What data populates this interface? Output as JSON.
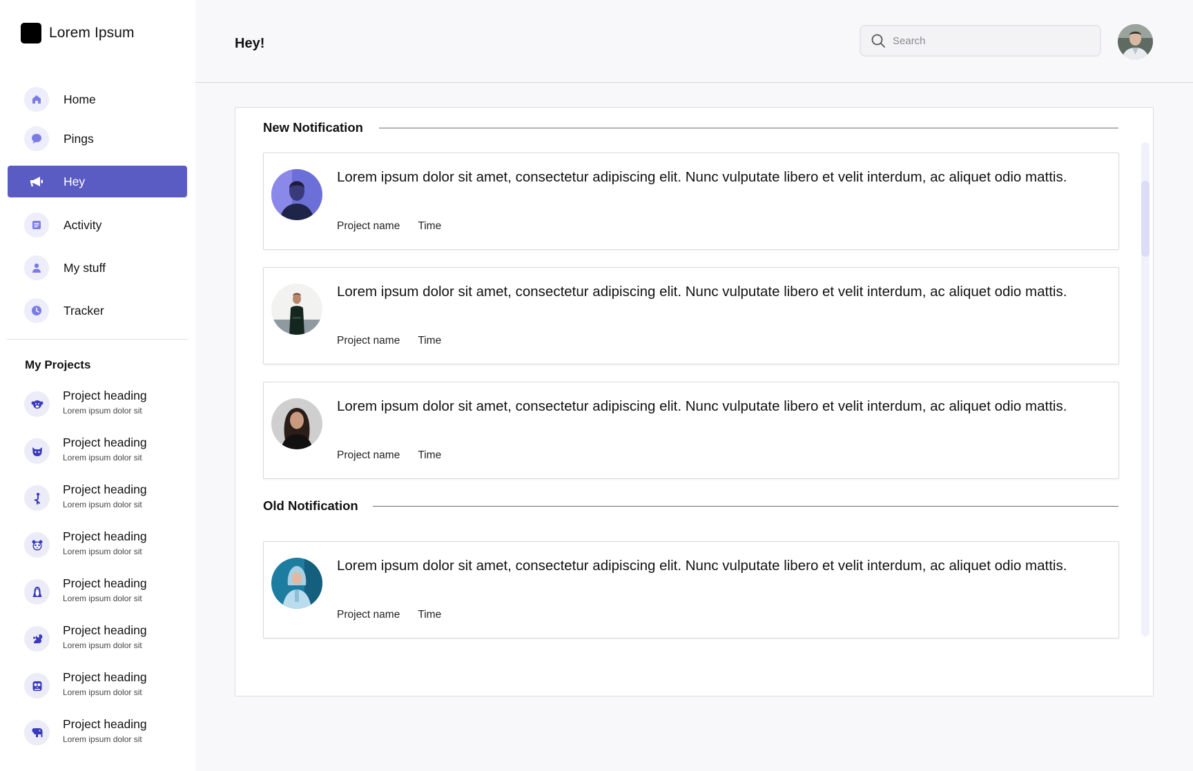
{
  "brand": {
    "name": "Lorem Ipsum"
  },
  "nav": [
    {
      "label": "Home",
      "icon": "home-icon",
      "active": false
    },
    {
      "label": "Pings",
      "icon": "chat-bubble-icon",
      "active": false
    },
    {
      "label": "Hey",
      "icon": "megaphone-icon",
      "active": true
    },
    {
      "label": "Activity",
      "icon": "document-icon",
      "active": false
    },
    {
      "label": "My stuff",
      "icon": "user-icon",
      "active": false
    },
    {
      "label": "Tracker",
      "icon": "clock-icon",
      "active": false
    }
  ],
  "projects": {
    "title": "My Projects",
    "items": [
      {
        "heading": "Project heading",
        "sub": "Lorem ipsum dolor sit",
        "icon": "monkey-icon"
      },
      {
        "heading": "Project heading",
        "sub": "Lorem ipsum dolor sit",
        "icon": "cat-icon"
      },
      {
        "heading": "Project heading",
        "sub": "Lorem ipsum dolor sit",
        "icon": "bird-icon"
      },
      {
        "heading": "Project heading",
        "sub": "Lorem ipsum dolor sit",
        "icon": "panda-icon"
      },
      {
        "heading": "Project heading",
        "sub": "Lorem ipsum dolor sit",
        "icon": "penguin-icon"
      },
      {
        "heading": "Project heading",
        "sub": "Lorem ipsum dolor sit",
        "icon": "squirrel-icon"
      },
      {
        "heading": "Project heading",
        "sub": "Lorem ipsum dolor sit",
        "icon": "owl-icon"
      },
      {
        "heading": "Project heading",
        "sub": "Lorem ipsum dolor sit",
        "icon": "elephant-icon"
      }
    ]
  },
  "header": {
    "title": "Hey!",
    "search_placeholder": "Search"
  },
  "notifications": {
    "new_title": "New Notification",
    "old_title": "Old Notification",
    "new_items": [
      {
        "text": "Lorem ipsum dolor sit amet, consectetur adipiscing elit. Nunc vulputate libero et velit interdum, ac aliquet odio mattis.",
        "project": "Project name",
        "time": "Time"
      },
      {
        "text": "Lorem ipsum dolor sit amet, consectetur adipiscing elit. Nunc vulputate libero et velit interdum, ac aliquet odio mattis.",
        "project": "Project name",
        "time": "Time"
      },
      {
        "text": "Lorem ipsum dolor sit amet, consectetur adipiscing elit. Nunc vulputate libero et velit interdum, ac aliquet odio mattis.",
        "project": "Project name",
        "time": "Time"
      }
    ],
    "old_items": [
      {
        "text": "Lorem ipsum dolor sit amet, consectetur adipiscing elit. Nunc vulputate libero et velit interdum, ac aliquet odio mattis.",
        "project": "Project name",
        "time": "Time"
      }
    ]
  },
  "colors": {
    "accent": "#5b5bc4",
    "icon_bg": "#ededfb",
    "icon_fg": "#7b7be6",
    "project_icon_fg": "#3b3bbd"
  }
}
